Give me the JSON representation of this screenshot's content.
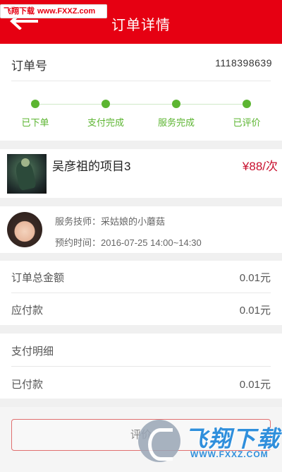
{
  "watermark": {
    "top_site_name": "飞翔下载",
    "top_url": "www.FXXZ.com",
    "bottom_title": "飞翔下载",
    "bottom_url": "WWW.FXXZ.COM"
  },
  "header": {
    "title": "订单详情",
    "back_icon": "back-arrow-icon",
    "background_color": "#e60012"
  },
  "order": {
    "number_label": "订单号",
    "number_value": "1118398639"
  },
  "steps": {
    "accent_color": "#5cb531",
    "items": [
      {
        "label": "已下单"
      },
      {
        "label": "支付完成"
      },
      {
        "label": "服务完成"
      },
      {
        "label": "已评价"
      }
    ]
  },
  "project": {
    "name": "吴彦祖的项目3",
    "price": "¥88/次",
    "price_color": "#c8102e"
  },
  "technician": {
    "name_line": "服务技师：采姑娘的小蘑菇",
    "time_line": "预约时间：2016-07-25 14:00~14:30"
  },
  "amounts": {
    "total_label": "订单总金额",
    "total_value": "0.01元",
    "payable_label": "应付款",
    "payable_value": "0.01元"
  },
  "payment": {
    "title": "支付明细",
    "paid_label": "已付款",
    "paid_value": "0.01元"
  },
  "footer": {
    "review_button_label": "评价"
  }
}
